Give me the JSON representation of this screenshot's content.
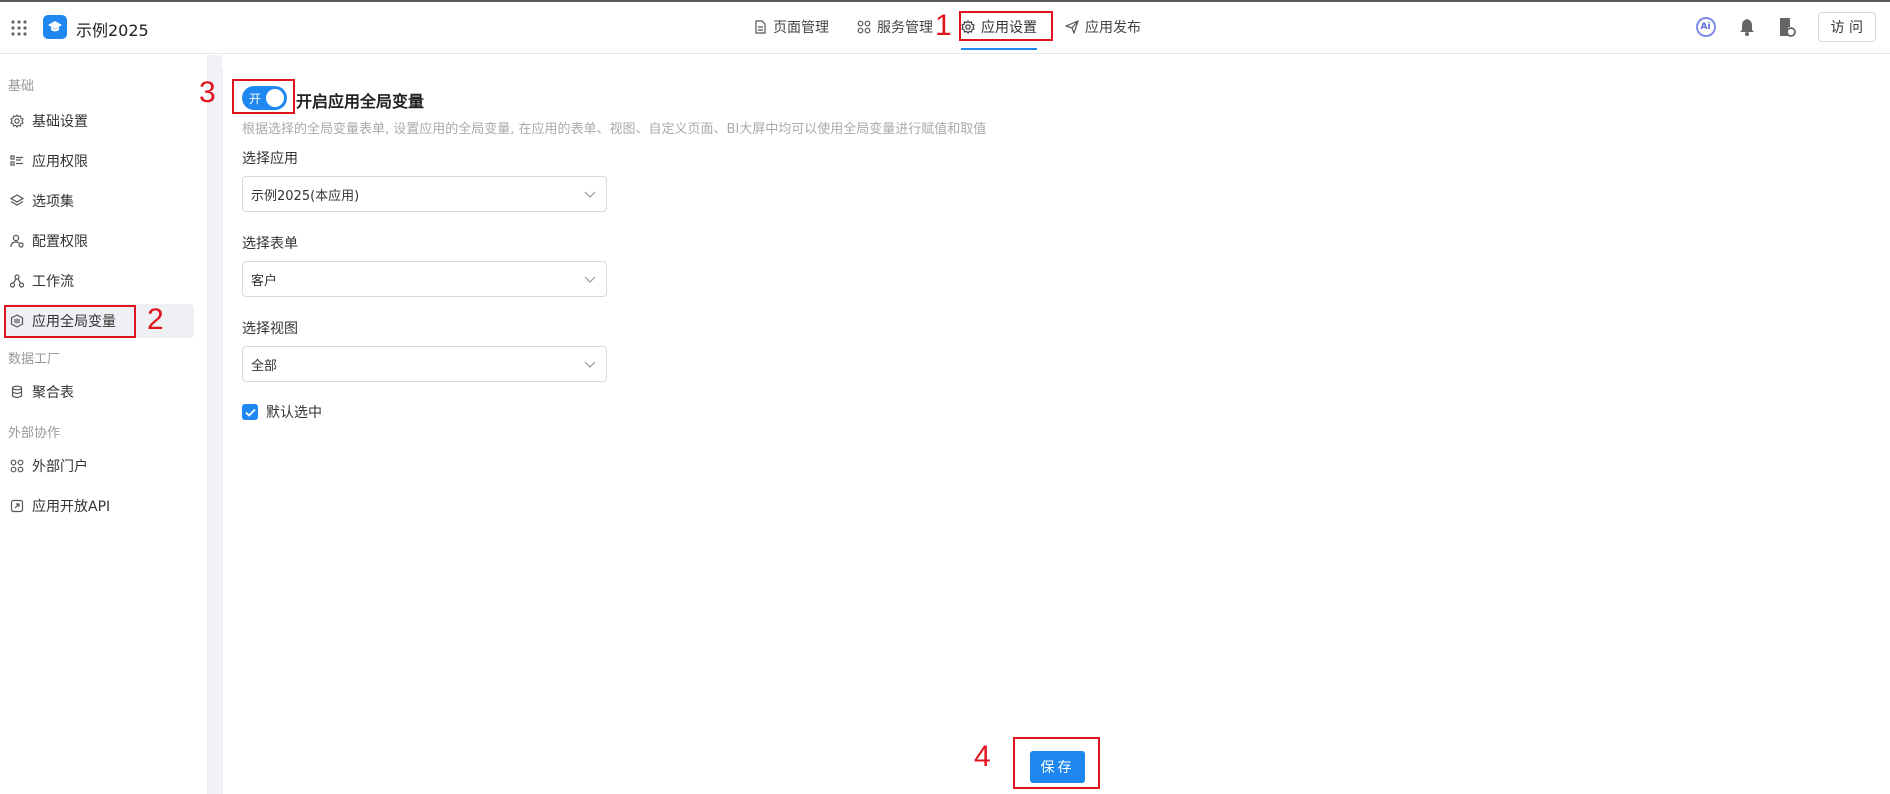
{
  "header": {
    "app_title": "示例2025",
    "nav": [
      {
        "label": "页面管理",
        "icon": "file-icon"
      },
      {
        "label": "服务管理",
        "icon": "apps-icon"
      },
      {
        "label": "应用设置",
        "icon": "gear-icon",
        "active": true
      },
      {
        "label": "应用发布",
        "icon": "send-icon"
      }
    ],
    "ai_label": "Ai",
    "visit_label": "访 问"
  },
  "sidebar": {
    "sections": [
      {
        "title": "基础",
        "items": [
          {
            "label": "基础设置",
            "icon": "gear-icon"
          },
          {
            "label": "应用权限",
            "icon": "list-icon"
          },
          {
            "label": "选项集",
            "icon": "layers-icon"
          },
          {
            "label": "配置权限",
            "icon": "user-config-icon"
          },
          {
            "label": "工作流",
            "icon": "workflow-icon"
          },
          {
            "label": "应用全局变量",
            "icon": "global-variable-icon",
            "active": true
          }
        ]
      },
      {
        "title": "数据工厂",
        "items": [
          {
            "label": "聚合表",
            "icon": "database-icon"
          }
        ]
      },
      {
        "title": "外部协作",
        "items": [
          {
            "label": "外部门户",
            "icon": "portal-icon"
          },
          {
            "label": "应用开放API",
            "icon": "api-icon"
          }
        ]
      }
    ]
  },
  "main": {
    "toggle_label": "开",
    "toggle_on": true,
    "title": "开启应用全局变量",
    "description": "根据选择的全局变量表单, 设置应用的全局变量, 在应用的表单、视图、自定义页面、BI大屏中均可以使用全局变量进行赋值和取值",
    "fields": [
      {
        "label": "选择应用",
        "value": "示例2025(本应用)"
      },
      {
        "label": "选择表单",
        "value": "客户"
      },
      {
        "label": "选择视图",
        "value": "全部"
      }
    ],
    "checkbox_label": "默认选中",
    "checkbox_checked": true,
    "save_label": "保存"
  },
  "annotations": [
    "1",
    "2",
    "3",
    "4"
  ],
  "colors": {
    "accent": "#1e88f0",
    "annotation": "#e0141f"
  }
}
